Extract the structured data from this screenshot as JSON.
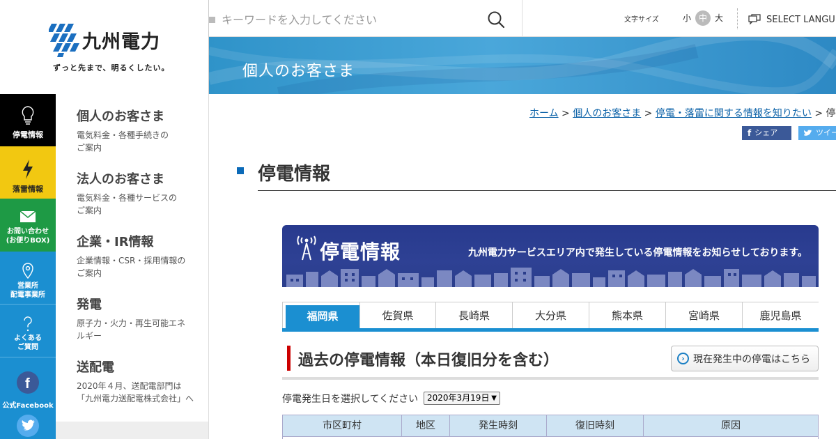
{
  "brand": {
    "name": "九州電力",
    "tagline": "ずっと先まで、明るくしたい。"
  },
  "search": {
    "placeholder": "キーワードを入力してください"
  },
  "utility": {
    "font_size_label": "文字サイズ",
    "font_sizes": [
      "小",
      "中",
      "大"
    ],
    "font_size_selected": "中",
    "language_label": "SELECT LANGU"
  },
  "banner": {
    "title": "個人のお客さま"
  },
  "icon_nav": [
    {
      "label": "停電情報",
      "color": "#000000"
    },
    {
      "label": "落雷情報",
      "color": "#f2c811"
    },
    {
      "label": "お問い合わせ\n(お便りBOX)",
      "color": "#1e9a45"
    },
    {
      "label": "営業所\n配電事業所",
      "color": "#1b8fd1"
    },
    {
      "label": "よくある\nご質問",
      "color": "#1b8fd1"
    },
    {
      "label": "公式Facebook",
      "color": "#1b8fd1"
    }
  ],
  "sub_nav": [
    {
      "title": "個人のお客さま",
      "desc": "電気料金・各種手続きの\nご案内"
    },
    {
      "title": "法人のお客さま",
      "desc": "電気料金・各種サービスの\nご案内"
    },
    {
      "title": "企業・IR情報",
      "desc": "企業情報・CSR・採用情報の\nご案内"
    },
    {
      "title": "発電",
      "desc": "原子力・火力・再生可能エネ\nルギー"
    },
    {
      "title": "送配電",
      "desc": "2020年４月、送配電部門は\n「九州電力送配電株式会社」へ"
    }
  ],
  "breadcrumb": {
    "links": [
      "ホーム",
      "個人のお客さま",
      "停電・落雷に関する情報を知りたい"
    ],
    "separator": " > ",
    "current": "停電"
  },
  "share": {
    "facebook": "シェア",
    "twitter": "ツイー"
  },
  "page": {
    "title": "停電情報"
  },
  "hero": {
    "title": "停電情報",
    "description": "九州電力サービスエリア内で発生している停電情報をお知らせしております。"
  },
  "tabs": [
    "福岡県",
    "佐賀県",
    "長崎県",
    "大分県",
    "熊本県",
    "宮崎県",
    "鹿児島県"
  ],
  "section": {
    "title": "過去の停電情報（本日復旧分を含む）",
    "current_button": "現在発生中の停電はこちら"
  },
  "date_filter": {
    "label": "停電発生日を選択してください",
    "selected": "2020年3月19日"
  },
  "table": {
    "headers": [
      "市区町村",
      "地区",
      "発生時刻",
      "復旧時刻",
      "原因"
    ]
  }
}
